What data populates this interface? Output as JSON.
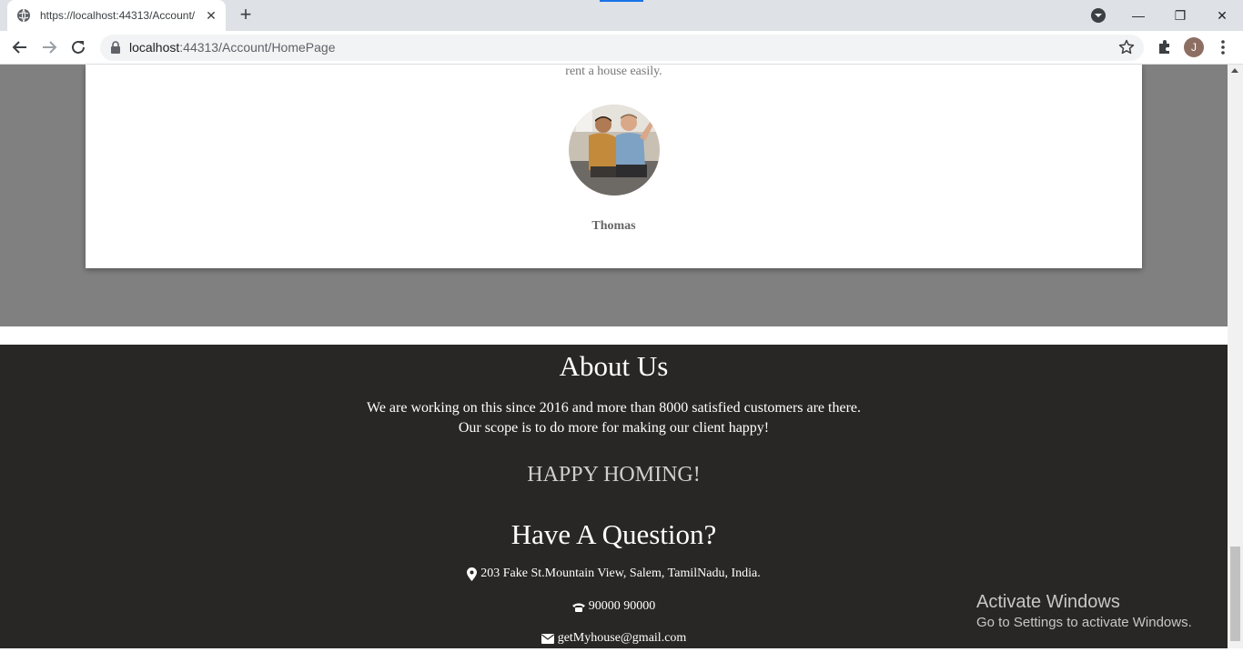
{
  "browser": {
    "tab_title": "https://localhost:44313/Account/",
    "tab_close": "✕",
    "new_tab": "+",
    "url_host": "localhost",
    "url_rest": ":44313/Account/HomePage",
    "avatar_letter": "J",
    "window_minimize": "—",
    "window_restore": "❐",
    "window_close": "✕"
  },
  "testimonial": {
    "text": "rent a house easily.",
    "name": "Thomas"
  },
  "footer": {
    "about_title": "About Us",
    "about_line1": "We are working on this since 2016 and more than 8000 satisfied customers are there.",
    "about_line2": "Our scope is to do more for making our client happy!",
    "tagline": "HAPPY HOMING!",
    "question_title": "Have A Question?",
    "address": "203 Fake St.Mountain View, Salem, TamilNadu, India.",
    "phone": "90000 90000",
    "email": "getMyhouse@gmail.com"
  },
  "watermark": {
    "title": "Activate Windows",
    "subtitle": "Go to Settings to activate Windows."
  },
  "icons": [
    "globe-icon",
    "back-icon",
    "forward-icon",
    "reload-icon",
    "lock-icon",
    "star-icon",
    "extensions-icon",
    "more-icon",
    "map-marker-icon",
    "phone-icon",
    "envelope-icon"
  ],
  "colors": {
    "footer_bg": "#292726",
    "gray_band": "#808080",
    "tagline": "#cfcfcf"
  }
}
